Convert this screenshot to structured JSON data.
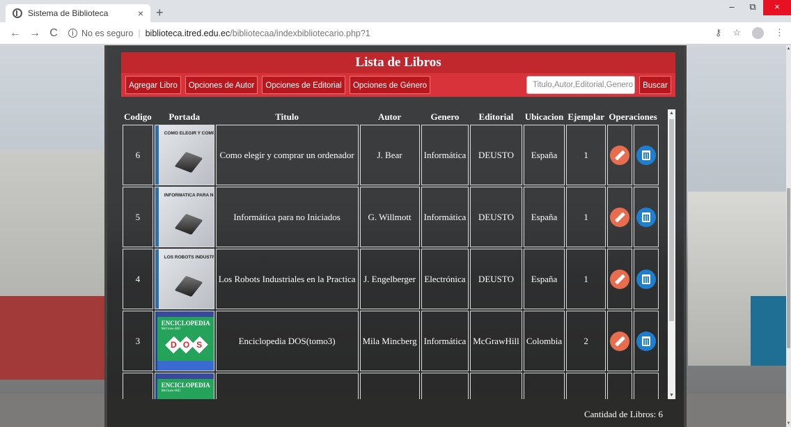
{
  "browser": {
    "tab_title": "Sistema de Biblioteca",
    "tab_close": "×",
    "new_tab": "+",
    "window_controls": {
      "minimize": "–",
      "maximize": "⧉",
      "close": "×"
    },
    "nav": {
      "back": "←",
      "forward": "→",
      "reload": "C"
    },
    "address": {
      "info": "i",
      "security_label": "No es seguro",
      "separator": "|",
      "host": "biblioteca.itred.edu.ec",
      "path": "/bibliotecaa/indexbibliotecario.php?1"
    },
    "toolbar_icons": {
      "key": "⚷",
      "star": "☆",
      "menu": "⋮"
    }
  },
  "page": {
    "title": "Lista de Libros",
    "buttons": {
      "add_book": "Agregar Libro",
      "author_options": "Opciones de Autor",
      "publisher_options": "Opciones de Editorial",
      "genre_options": "Opciones de Género",
      "search": "Buscar"
    },
    "search_placeholder": "Titulo,Autor,Editorial,Genero",
    "table": {
      "headers": [
        "Codigo",
        "Portada",
        "Titulo",
        "Autor",
        "Genero",
        "Editorial",
        "Ubicacion",
        "Ejemplar",
        "Operaciones"
      ],
      "rows": [
        {
          "codigo": "6",
          "titulo": "Como elegir y comprar un ordenador",
          "autor": "J. Bear",
          "genero": "Informática",
          "editorial": "DEUSTO",
          "ubicacion": "España",
          "ejemplar": "1",
          "cover_text": "COMO ELEGIR Y COMPRAR UN ORDENADOR"
        },
        {
          "codigo": "5",
          "titulo": "Informática para no Iniciados",
          "autor": "G. Willmott",
          "genero": "Informática",
          "editorial": "DEUSTO",
          "ubicacion": "España",
          "ejemplar": "1",
          "cover_text": "INFORMATICA PARA NO INICIADOS"
        },
        {
          "codigo": "4",
          "titulo": "Los Robots Industriales en la Practica",
          "autor": "J. Engelberger",
          "genero": "Electrónica",
          "editorial": "DEUSTO",
          "ubicacion": "España",
          "ejemplar": "1",
          "cover_text": "LOS ROBOTS INDUSTRIALES EN LA PRACTICA"
        },
        {
          "codigo": "3",
          "titulo": "Enciclopedia DOS(tomo3)",
          "autor": "Mila Mincberg",
          "genero": "Informática",
          "editorial": "McGrawHill",
          "ubicacion": "Colombia",
          "ejemplar": "2",
          "cover_text": "ENCICLOPEDIA",
          "cover_sub": "McGraw-Hill",
          "cover_dos": [
            "D",
            "O",
            "S"
          ]
        }
      ],
      "partial_row_cover": {
        "cover_text": "ENCICLOPEDIA",
        "cover_sub": "McGraw-Hill"
      }
    },
    "count_label": "Cantidad de Libros: 6"
  },
  "colors": {
    "header_red": "#c0282e",
    "button_red": "#b8171d",
    "edit": "#e86d4f",
    "delete": "#1e7ed0"
  }
}
